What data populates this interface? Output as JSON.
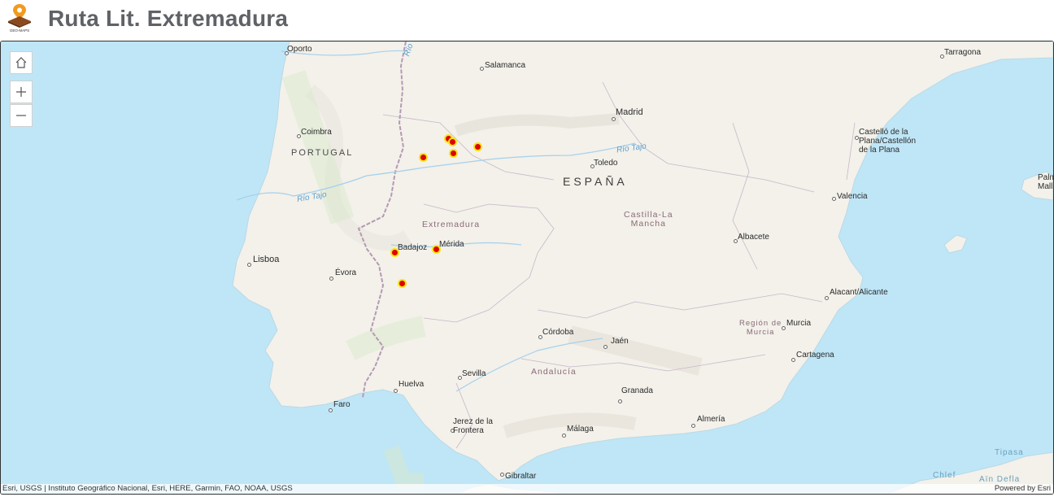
{
  "app": {
    "title": "Ruta Lit. Extremadura",
    "logo_icon": "geo-maps-logo",
    "logo_text": "GEO-MAPS"
  },
  "controls": {
    "home_icon": "home-icon",
    "zoom_in_icon": "plus-icon",
    "zoom_out_icon": "minus-icon"
  },
  "map": {
    "countries": [
      {
        "id": "portugal",
        "label": "PORTUGAL"
      },
      {
        "id": "espana",
        "label": "ESPAÑA"
      }
    ],
    "regions": [
      {
        "id": "extremadura",
        "label": "Extremadura"
      },
      {
        "id": "castilla",
        "label": "Castilla-La\nMancha"
      },
      {
        "id": "andalucia",
        "label": "Andalucía"
      },
      {
        "id": "murcia",
        "label": "Región de\nMurcia"
      }
    ],
    "rivers": [
      {
        "id": "tajo-west",
        "label": "Río Tajo"
      },
      {
        "id": "tajo-east",
        "label": "Río Tajo"
      },
      {
        "id": "duero",
        "label": "Río"
      }
    ],
    "cities": [
      {
        "id": "oporto",
        "label": "Oporto"
      },
      {
        "id": "salamanca",
        "label": "Salamanca"
      },
      {
        "id": "madrid",
        "label": "Madrid"
      },
      {
        "id": "tarragona",
        "label": "Tarragona"
      },
      {
        "id": "coimbra",
        "label": "Coimbra"
      },
      {
        "id": "toledo",
        "label": "Toledo"
      },
      {
        "id": "castello",
        "label": "Castelló de la\nPlana/Castellón\nde la Plana"
      },
      {
        "id": "valencia",
        "label": "Valencia"
      },
      {
        "id": "palma",
        "label": "Palm\nMall"
      },
      {
        "id": "badajoz",
        "label": "Badajoz"
      },
      {
        "id": "merida",
        "label": "Mérida"
      },
      {
        "id": "albacete",
        "label": "Albacete"
      },
      {
        "id": "lisboa",
        "label": "Lisboa"
      },
      {
        "id": "evora",
        "label": "Évora"
      },
      {
        "id": "alacant",
        "label": "Alacant/Alicante"
      },
      {
        "id": "murcia-city",
        "label": "Murcia"
      },
      {
        "id": "cordoba",
        "label": "Córdoba"
      },
      {
        "id": "jaen",
        "label": "Jaén"
      },
      {
        "id": "cartagena",
        "label": "Cartagena"
      },
      {
        "id": "sevilla",
        "label": "Sevilla"
      },
      {
        "id": "huelva",
        "label": "Huelva"
      },
      {
        "id": "granada",
        "label": "Granada"
      },
      {
        "id": "almeria",
        "label": "Almería"
      },
      {
        "id": "faro",
        "label": "Faro"
      },
      {
        "id": "jerez",
        "label": "Jerez de la\nFrontera"
      },
      {
        "id": "malaga",
        "label": "Málaga"
      },
      {
        "id": "gibraltar",
        "label": "Gibraltar"
      },
      {
        "id": "tipasa",
        "label": "Tipasa"
      },
      {
        "id": "chlef",
        "label": "Chlef"
      },
      {
        "id": "aindefla",
        "label": "Aïn Defla"
      }
    ],
    "point_color": "#e00000",
    "point_ring_color": "#f5e313"
  },
  "attribution": {
    "left": "Esri, USGS | Instituto Geográfico Nacional, Esri, HERE, Garmin, FAO, NOAA, USGS",
    "right": "Powered by Esri"
  }
}
